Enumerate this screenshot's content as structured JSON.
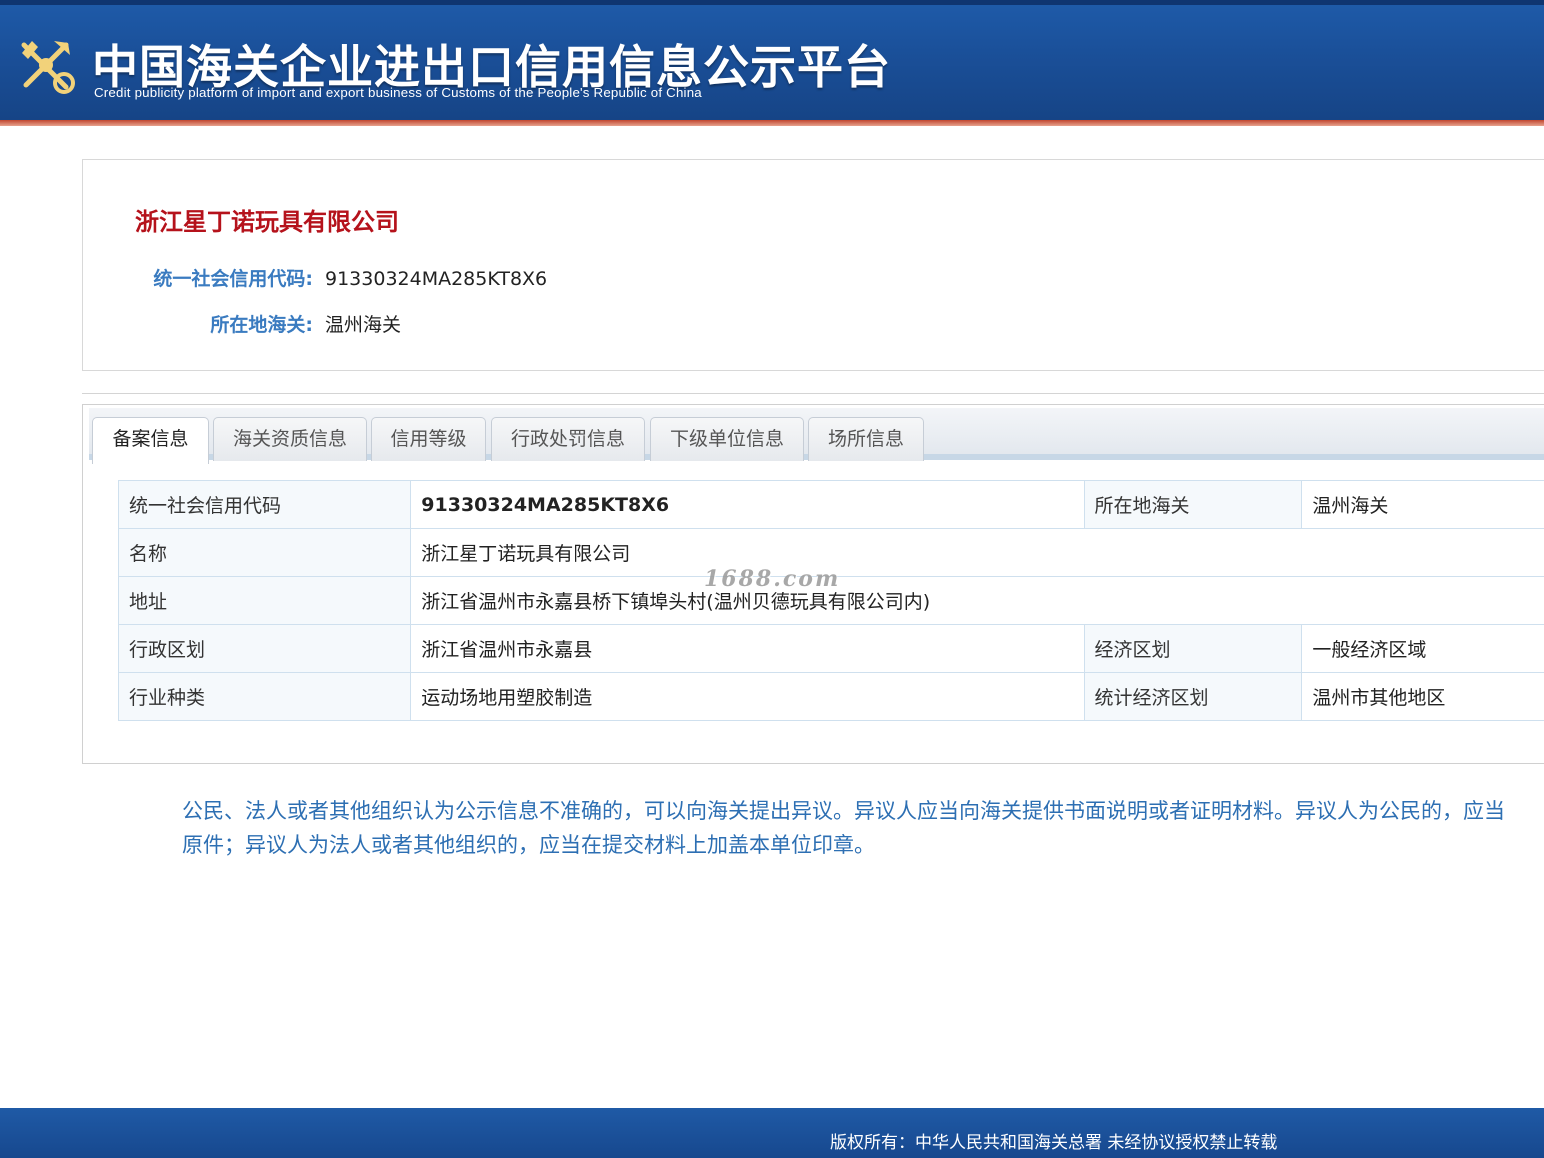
{
  "header": {
    "title": "中国海关企业进出口信用信息公示平台",
    "subtitle": "Credit publicity platform of import and export business of Customs of the People's Republic of China",
    "logo_icon": "customs-emblem-icon"
  },
  "company": {
    "name": "浙江星丁诺玩具有限公司",
    "credit_code_label": "统一社会信用代码:",
    "credit_code": "91330324MA285KT8X6",
    "customs_label": "所在地海关:",
    "customs": "温州海关"
  },
  "tabs": [
    {
      "label": "备案信息",
      "active": true
    },
    {
      "label": "海关资质信息",
      "active": false
    },
    {
      "label": "信用等级",
      "active": false
    },
    {
      "label": "行政处罚信息",
      "active": false
    },
    {
      "label": "下级单位信息",
      "active": false
    },
    {
      "label": "场所信息",
      "active": false
    }
  ],
  "record": {
    "credit_code_label": "统一社会信用代码",
    "credit_code": "91330324MA285KT8X6",
    "customs_label": "所在地海关",
    "customs": "温州海关",
    "name_label": "名称",
    "name": "浙江星丁诺玩具有限公司",
    "address_label": "地址",
    "address": "浙江省温州市永嘉县桥下镇埠头村(温州贝德玩具有限公司内)",
    "admin_region_label": "行政区划",
    "admin_region": "浙江省温州市永嘉县",
    "econ_region_label": "经济区划",
    "econ_region": "一般经济区域",
    "industry_label": "行业种类",
    "industry": "运动场地用塑胶制造",
    "stat_region_label": "统计经济区划",
    "stat_region": "温州市其他地区"
  },
  "watermark": "1688.com",
  "notice": {
    "line1": "公民、法人或者其他组织认为公示信息不准确的，可以向海关提出异议。异议人应当向海关提供书面说明或者证明材料。异议人为公民的，应当",
    "line2": "原件；异议人为法人或者其他组织的，应当在提交材料上加盖本单位印章。"
  },
  "footer": {
    "text": "版权所有：中华人民共和国海关总署    未经协议授权禁止转载"
  },
  "colors": {
    "header_blue": "#1a4f98",
    "accent_red": "#b5121b",
    "label_blue": "#3a7bc0",
    "notice_blue": "#2d6fb3"
  }
}
